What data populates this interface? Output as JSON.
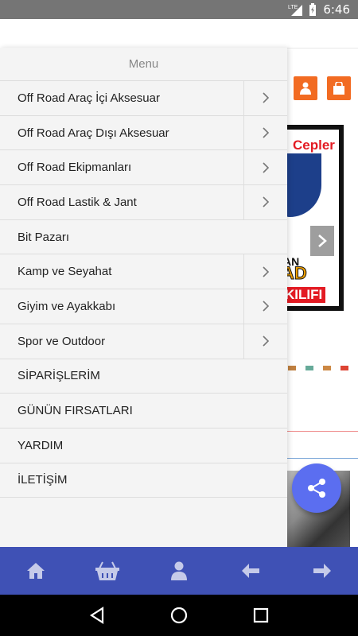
{
  "status_bar": {
    "network": "LTE",
    "time": "6:46"
  },
  "background": {
    "banner_text_top": "Cepler",
    "banner_text_mid": "AN",
    "banner_text_road": "AD",
    "banner_text_bottom": "KILIFI"
  },
  "drawer": {
    "title": "Menu",
    "items": [
      {
        "label": "Off Road Araç İçi Aksesuar",
        "has_submenu": true
      },
      {
        "label": "Off Road Araç Dışı Aksesuar",
        "has_submenu": true
      },
      {
        "label": "Off Road Ekipmanları",
        "has_submenu": true
      },
      {
        "label": "Off Road Lastik & Jant",
        "has_submenu": true
      },
      {
        "label": "Bit Pazarı",
        "has_submenu": false
      },
      {
        "label": "Kamp ve Seyahat",
        "has_submenu": true
      },
      {
        "label": "Giyim ve Ayakkabı",
        "has_submenu": true
      },
      {
        "label": "Spor ve Outdoor",
        "has_submenu": true
      },
      {
        "label": "SİPARİŞLERİM",
        "has_submenu": false
      },
      {
        "label": "GÜNÜN FIRSATLARI",
        "has_submenu": false
      },
      {
        "label": "YARDIM",
        "has_submenu": false
      },
      {
        "label": "İLETİŞİM",
        "has_submenu": false
      }
    ]
  },
  "bottom_nav": {
    "icons": [
      "home-icon",
      "basket-icon",
      "user-icon",
      "arrow-left-icon",
      "arrow-right-icon"
    ]
  },
  "colors": {
    "accent_orange": "#f26b22",
    "nav_blue": "#3f51b5",
    "fab_blue": "#5b6ef0"
  }
}
